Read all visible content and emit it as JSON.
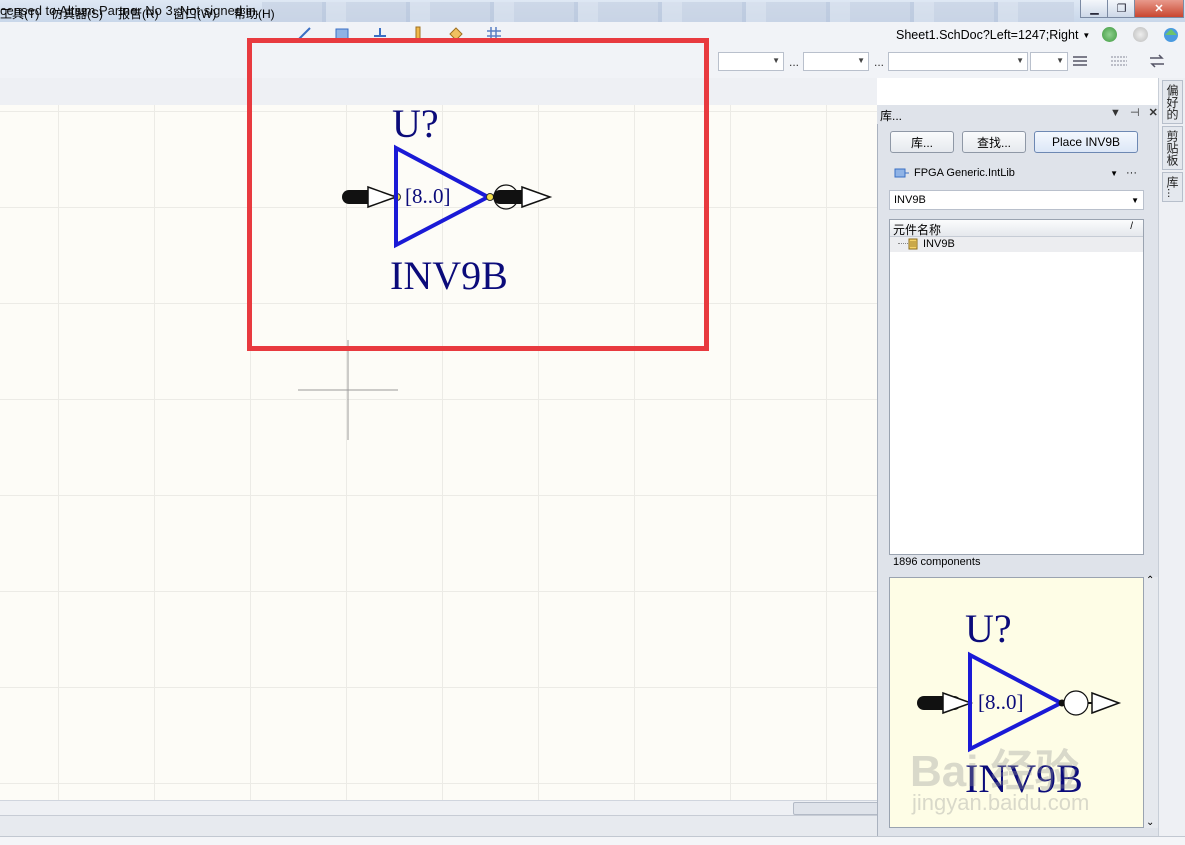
{
  "title_bar": {
    "text": "censed to Altium Partner No 3. Not signed in."
  },
  "menu": [
    {
      "label": "工具(T)"
    },
    {
      "label": "仿真器(S)"
    },
    {
      "label": "报告(R)"
    },
    {
      "label": "窗口(W)"
    },
    {
      "label": "帮助(H)"
    }
  ],
  "address_bar": {
    "value": "Sheet1.SchDoc?Left=1247;Right"
  },
  "canvas_symbol": {
    "designator": "U?",
    "bus_label": "[8..0]",
    "part_name": "INV9B"
  },
  "library_panel": {
    "title": "库...",
    "buttons": {
      "libraries": "库...",
      "search": "查找...",
      "place": "Place INV9B"
    },
    "library_name": "FPGA Generic.IntLib",
    "filter_value": "INV9B",
    "column_header": "元件名称",
    "column_sort_indicator": "/",
    "components": [
      "INV9B"
    ],
    "component_count": "1896 components",
    "preview": {
      "designator": "U?",
      "bus_label": "[8..0]",
      "part_name": "INV9B"
    }
  },
  "side_tabs": [
    "偏好的",
    "剪贴板",
    "库..."
  ],
  "watermark": {
    "line1": "Bai 经验",
    "line2": "jingyan.baidu.com"
  },
  "colors": {
    "highlight": "#e83a3f",
    "symbol_blue": "#1a1ad6",
    "text_navy": "#0b0b7a"
  }
}
